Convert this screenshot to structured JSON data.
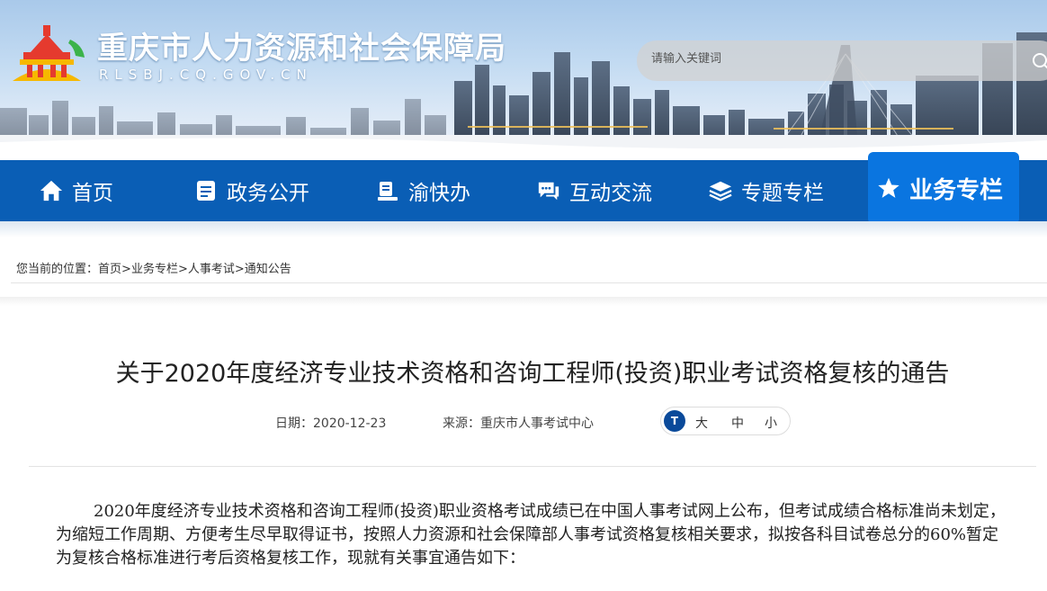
{
  "header": {
    "site_title": "重庆市人力资源和社会保障局",
    "site_domain": "RLSBJ.CQ.GOV.CN",
    "search": {
      "placeholder": "请输入关键词"
    }
  },
  "nav": {
    "items": [
      {
        "label": "首页",
        "icon": "home-icon"
      },
      {
        "label": "政务公开",
        "icon": "document-icon"
      },
      {
        "label": "渝快办",
        "icon": "service-icon"
      },
      {
        "label": "互动交流",
        "icon": "chat-icon"
      },
      {
        "label": "专题专栏",
        "icon": "layers-icon"
      },
      {
        "label": "业务专栏",
        "icon": "star-icon",
        "active": true
      }
    ]
  },
  "breadcrumb": {
    "prefix": "您当前的位置：",
    "items": [
      "首页",
      "业务专栏",
      "人事考试",
      "通知公告"
    ],
    "separator": ">"
  },
  "article": {
    "title": "关于2020年度经济专业技术资格和咨询工程师(投资)职业考试资格复核的通告",
    "date_label": "日期：",
    "date": "2020-12-23",
    "source_label": "来源：",
    "source": "重庆市人事考试中心",
    "font_size": {
      "icon_text": "T",
      "large": "大",
      "medium": "中",
      "small": "小"
    },
    "body": "2020年度经济专业技术资格和咨询工程师(投资)职业资格考试成绩已在中国人事考试网上公布，但考试成绩合格标准尚未划定，为缩短工作周期、方便考生尽早取得证书，按照人力资源和社会保障部人事考试资格复核相关要求，拟按各科目试卷总分的60%暂定为复核合格标准进行考后资格复核工作，现就有关事宜通告如下："
  },
  "colors": {
    "nav_bg": "#0a5eb5",
    "nav_active": "#0a75e0",
    "fontsize_icon": "#0a4a9a"
  }
}
